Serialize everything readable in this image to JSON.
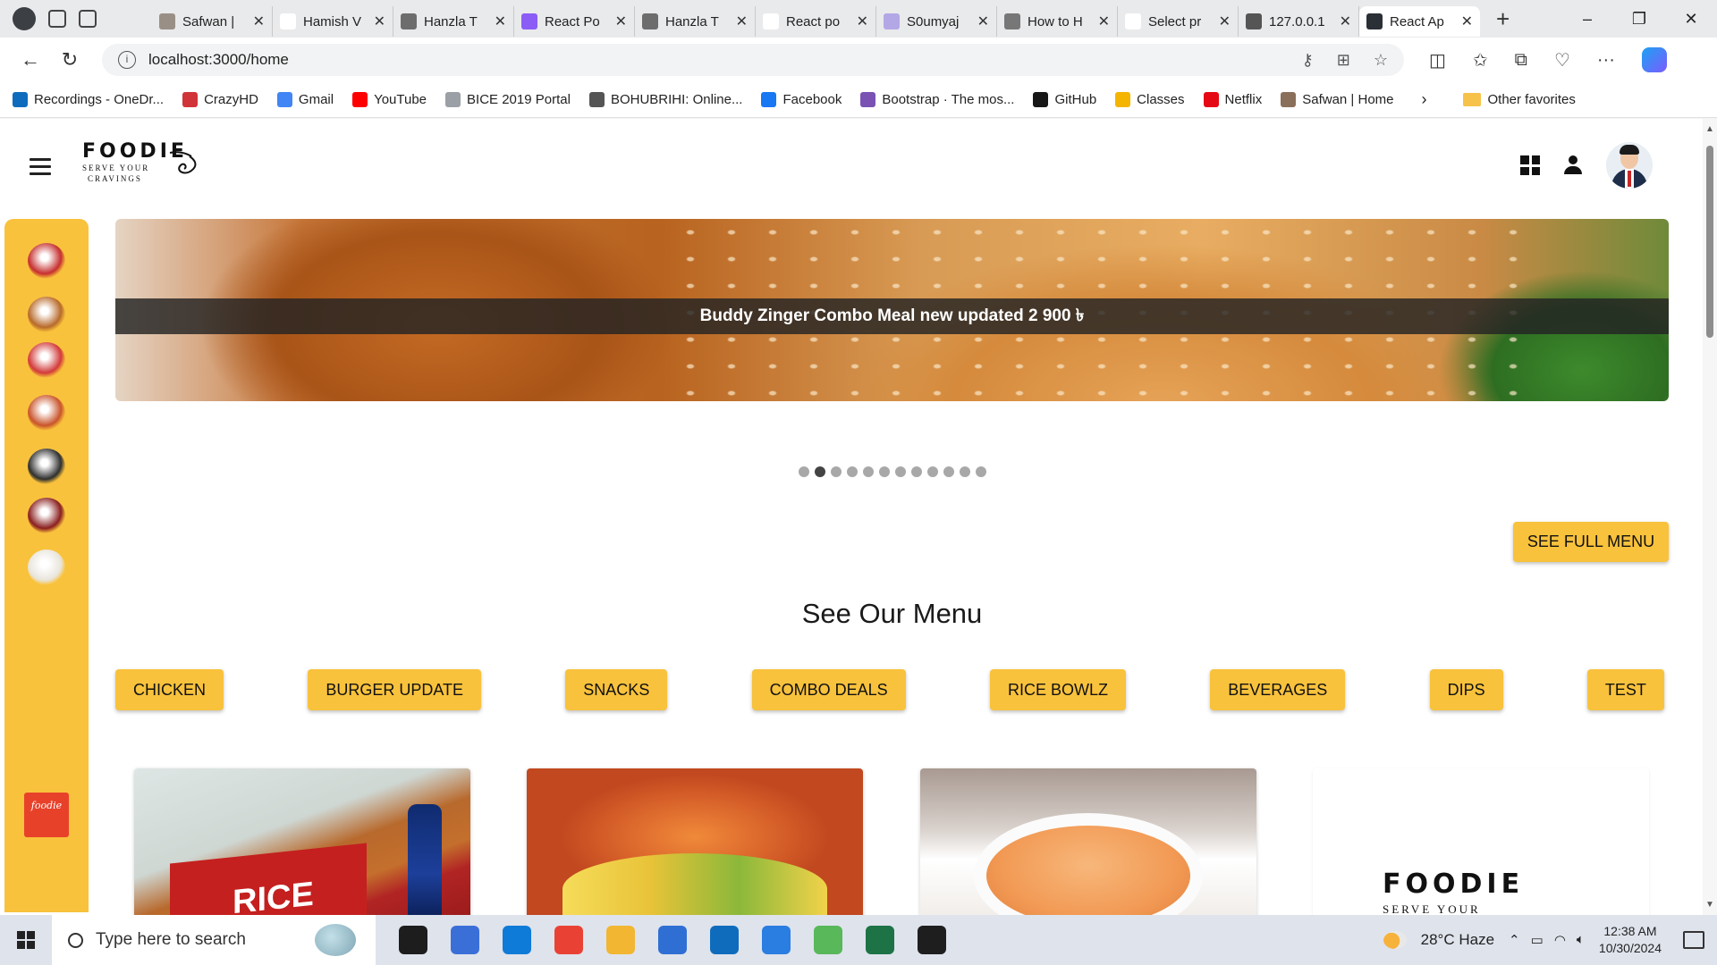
{
  "browser": {
    "tabs": [
      {
        "label": "Safwan |",
        "favicon_color": "#9a8f86"
      },
      {
        "label": "Hamish V",
        "favicon_color": "#ffffff"
      },
      {
        "label": "Hanzla T",
        "favicon_color": "#6d6d6d"
      },
      {
        "label": "React Po",
        "favicon_color": "#8b5cf6"
      },
      {
        "label": "Hanzla T",
        "favicon_color": "#6d6d6d"
      },
      {
        "label": "React po",
        "favicon_color": "#ffffff"
      },
      {
        "label": "S0umyaj",
        "favicon_color": "#b3a7e6"
      },
      {
        "label": "How to H",
        "favicon_color": "#777777"
      },
      {
        "label": "Select pr",
        "favicon_color": "#ffffff"
      },
      {
        "label": "127.0.0.1",
        "favicon_color": "#555555"
      },
      {
        "label": "React Ap",
        "favicon_color": "#2b2f36",
        "active": true
      }
    ],
    "new_tab": "+",
    "url": "localhost:3000/home",
    "bookmarks": [
      {
        "label": "Recordings - OneDr...",
        "color": "#0f6cbd"
      },
      {
        "label": "CrazyHD",
        "color": "#d13438"
      },
      {
        "label": "Gmail",
        "color": "#4285f4"
      },
      {
        "label": "YouTube",
        "color": "#ff0000"
      },
      {
        "label": "BICE 2019 Portal",
        "color": "#9aa0a6"
      },
      {
        "label": "BOHUBRIHI: Online...",
        "color": "#555555"
      },
      {
        "label": "Facebook",
        "color": "#1877f2"
      },
      {
        "label": "Bootstrap · The mos...",
        "color": "#7952b3"
      },
      {
        "label": "GitHub",
        "color": "#181717"
      },
      {
        "label": "Classes",
        "color": "#f4b400"
      },
      {
        "label": "Netflix",
        "color": "#e50914"
      },
      {
        "label": "Safwan | Home",
        "color": "#8a6f5a"
      }
    ],
    "other_favorites": "Other favorites"
  },
  "header": {
    "logo_word": "FOODIE",
    "logo_tagline_1": "SERVE YOUR",
    "logo_tagline_2": "CRAVINGS"
  },
  "sidebar": {
    "items": [
      {
        "name": "chicken-bucket",
        "color": "#c62f2f"
      },
      {
        "name": "burger",
        "color": "#b86a2a"
      },
      {
        "name": "snacks-bucket",
        "color": "#d23a3a"
      },
      {
        "name": "combo-deal",
        "color": "#c9542b"
      },
      {
        "name": "rice-bowl",
        "color": "#2f2f2f"
      },
      {
        "name": "beverage",
        "color": "#8a1f1f"
      },
      {
        "name": "dip",
        "color": "#e9e5dc"
      }
    ],
    "brand_tile": "foodie"
  },
  "banner": {
    "caption": "Buddy Zinger Combo Meal new updated 2  900 ৳",
    "slide_count": 12,
    "active_slide": 1
  },
  "menu": {
    "see_full_menu": "SEE FULL MENU",
    "title": "See Our Menu",
    "categories": [
      "CHICKEN",
      "BURGER UPDATE",
      "SNACKS",
      "COMBO DEALS",
      "RICE BOWLZ",
      "BEVERAGES",
      "DIPS",
      "TEST"
    ]
  },
  "cards": {
    "card1_box_text": "RICE",
    "card4_logo_word": "FOODIE",
    "card4_logo_tagline": "SERVE YOUR"
  },
  "taskbar": {
    "search_placeholder": "Type here to search",
    "weather": "28°C  Haze",
    "time": "12:38 AM",
    "date": "10/30/2024",
    "apps": [
      "#1d1d1d",
      "#3a6fd8",
      "#0f7bd8",
      "#e94235",
      "#f2b632",
      "#2f6fd4",
      "#0f6cbd",
      "#2a7de1",
      "#58b85a",
      "#1d7346",
      "#1e1e1e"
    ]
  },
  "accent_color": "#f9c23c"
}
